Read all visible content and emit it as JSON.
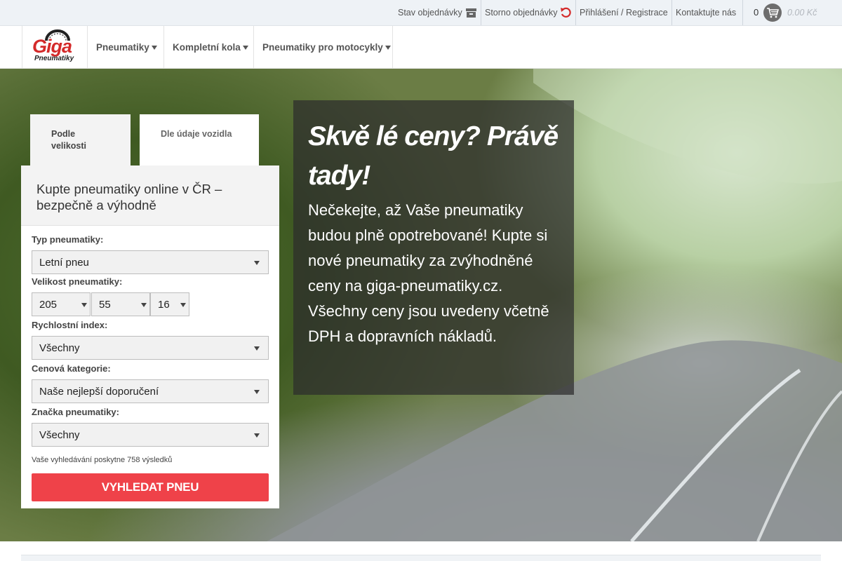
{
  "topbar": {
    "order_status": "Stav objednávky",
    "order_cancel": "Storno objednávky",
    "login": "Přihlášení / Registrace",
    "contact": "Kontaktujte nás",
    "cart_count": "0",
    "cart_total": "0.00 Kč",
    "colors": {
      "cancel_icon": "#d42a2a",
      "cart_icon_bg": "#6d6d6d"
    }
  },
  "logo": {
    "word": "Giga",
    "sub": "Pneumatiky"
  },
  "nav": {
    "items": [
      {
        "label": "Pneumatiky"
      },
      {
        "label": "Kompletní kola"
      },
      {
        "label": "Pneumatiky pro motocykly"
      }
    ]
  },
  "search": {
    "tabs": [
      {
        "label": "Podle velikosti",
        "active": true
      },
      {
        "label": "Dle údaje vozidla",
        "active": false
      }
    ],
    "heading": "Kupte pneumatiky online v ČR – bezpečně a výhodně",
    "type_label": "Typ pneumatiky:",
    "type_value": "Letní pneu",
    "size_label": "Velikost pneumatiky:",
    "width_value": "205",
    "profile_value": "55",
    "rim_value": "16",
    "speed_label": "Rychlostní index:",
    "speed_value": "Všechny",
    "price_label": "Cenová kategorie:",
    "price_value": "Naše nejlepší doporučení",
    "brand_label": "Značka pneumatiky:",
    "brand_value": "Všechny",
    "result_note": "Vaše vyhledávání poskytne 758 výsledků",
    "button": "VYHLEDAT PNEU",
    "colors": {
      "button": "#ef4249"
    }
  },
  "promo": {
    "title": "Skvě lé ceny? Právě tady!",
    "text": "Nečekejte, až Vaše pneumatiky budou plně opotrebované! Kupte si nové pneumatiky za zvýhodněné ceny na giga-pneumatiky.cz. Všechny ceny jsou uvedeny včetně DPH a dopravních nákladů."
  }
}
